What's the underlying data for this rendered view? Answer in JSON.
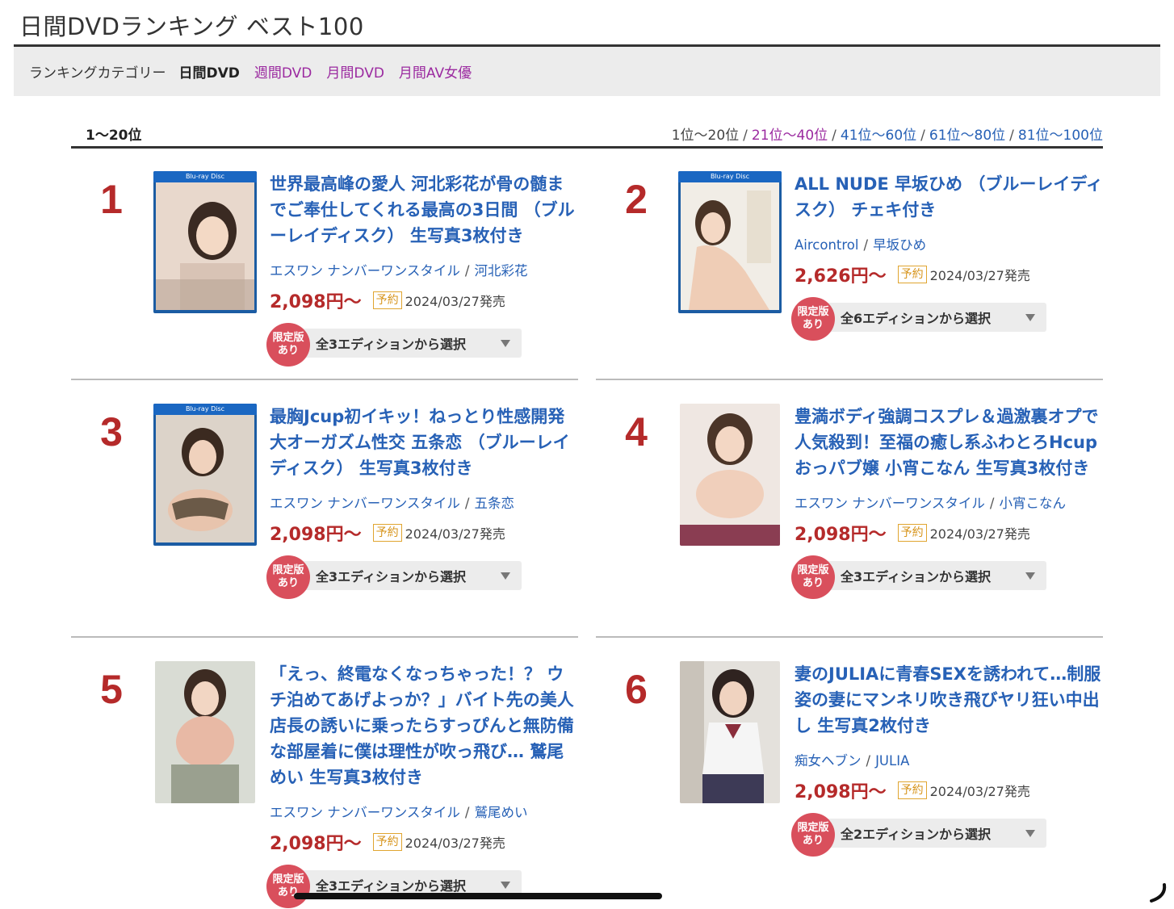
{
  "page": {
    "title": "日間DVDランキング ベスト100"
  },
  "category_bar": {
    "label": "ランキングカテゴリー",
    "items": [
      "日間DVD",
      "週間DVD",
      "月間DVD",
      "月間AV女優"
    ]
  },
  "range": {
    "current": "1〜20位",
    "nav": [
      "1位〜20位",
      "21位〜40位",
      "41位〜60位",
      "61位〜80位",
      "81位〜100位"
    ],
    "separator": "/"
  },
  "products": [
    {
      "rank": "1",
      "title": "世界最高峰の愛人 河北彩花が骨の髄までご奉仕してくれる最高の3日間 （ブルーレイディスク） 生写真3枚付き",
      "maker": "エスワン ナンバーワンスタイル",
      "actress": "河北彩花",
      "price": "2,098円〜",
      "badge": "予約",
      "date": "2024/03/27発売",
      "limited": [
        "限定版",
        "あり"
      ],
      "edition": "全3エディションから選択"
    },
    {
      "rank": "2",
      "title": "ALL NUDE 早坂ひめ （ブルーレイディスク） チェキ付き",
      "maker": "Aircontrol",
      "actress": "早坂ひめ",
      "price": "2,626円〜",
      "badge": "予約",
      "date": "2024/03/27発売",
      "limited": [
        "限定版",
        "あり"
      ],
      "edition": "全6エディションから選択"
    },
    {
      "rank": "3",
      "title": "最胸Jcup初イキッ！ねっとり性感開発大オーガズム性交 五条恋 （ブルーレイディスク） 生写真3枚付き",
      "maker": "エスワン ナンバーワンスタイル",
      "actress": "五条恋",
      "price": "2,098円〜",
      "badge": "予約",
      "date": "2024/03/27発売",
      "limited": [
        "限定版",
        "あり"
      ],
      "edition": "全3エディションから選択"
    },
    {
      "rank": "4",
      "title": "豊満ボディ強調コスプレ＆過激裏オプで人気殺到！至福の癒し系ふわとろHcupおっパブ嬢 小宵こなん 生写真3枚付き",
      "maker": "エスワン ナンバーワンスタイル",
      "actress": "小宵こなん",
      "price": "2,098円〜",
      "badge": "予約",
      "date": "2024/03/27発売",
      "limited": [
        "限定版",
        "あり"
      ],
      "edition": "全3エディションから選択"
    },
    {
      "rank": "5",
      "title": "「えっ、終電なくなっちゃった！？ ウチ泊めてあげよっか？」バイト先の美人店長の誘いに乗ったらすっぴんと無防備な部屋着に僕は理性が吹っ飛び… 鷲尾めい 生写真3枚付き",
      "maker": "エスワン ナンバーワンスタイル",
      "actress": "鷲尾めい",
      "price": "2,098円〜",
      "badge": "予約",
      "date": "2024/03/27発売",
      "limited": [
        "限定版",
        "あり"
      ],
      "edition": "全3エディションから選択"
    },
    {
      "rank": "6",
      "title": "妻のJULIAに青春SEXを誘われて…制服姿の妻にマンネリ吹き飛びヤリ狂い中出し 生写真2枚付き",
      "maker": "痴女ヘブン",
      "actress": "JULIA",
      "price": "2,098円〜",
      "badge": "予約",
      "date": "2024/03/27発売",
      "limited": [
        "限定版",
        "あり"
      ],
      "edition": "全2エディションから選択"
    }
  ],
  "colors": {
    "link": "#2761b6",
    "visited": "#9b2aa0",
    "price": "#b52a2a",
    "rank": "#b52a2a",
    "reserve_badge": "#d7941b",
    "limited_badge": "#d94f5c"
  }
}
